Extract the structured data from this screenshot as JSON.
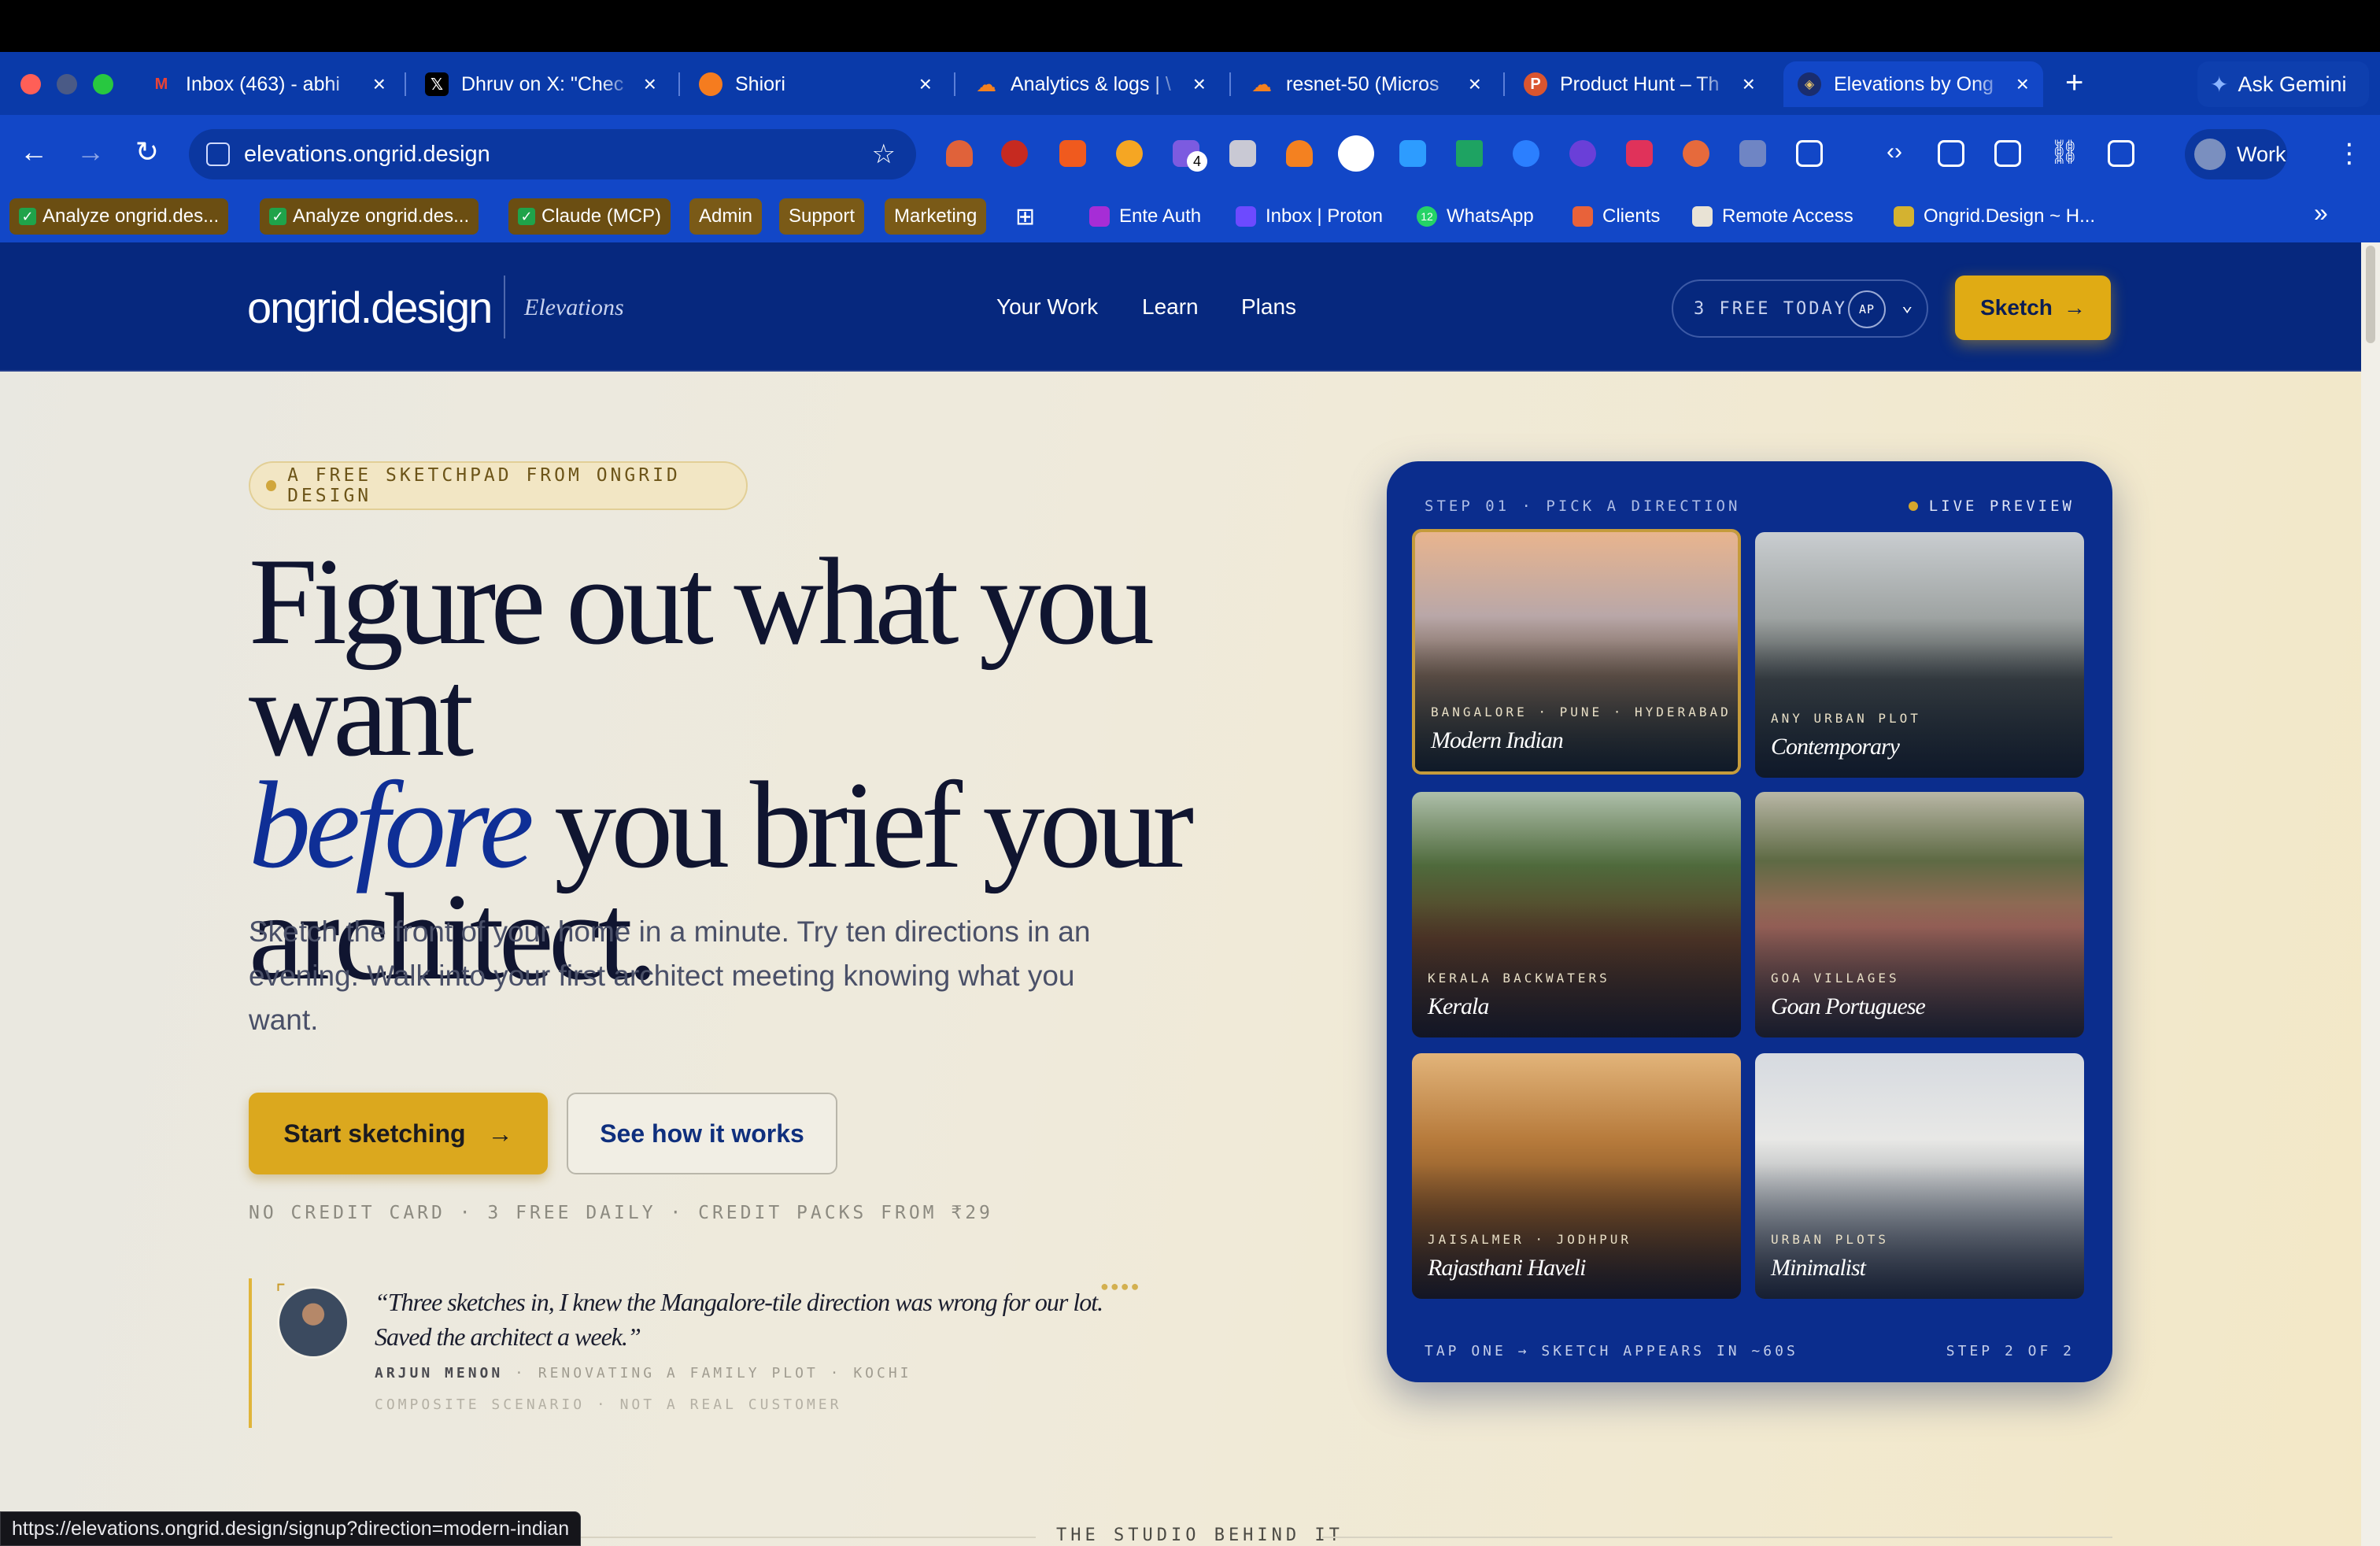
{
  "browser": {
    "tabs": [
      {
        "title": "Inbox (463) - abhi",
        "icon": "gmail-icon",
        "color": "#ea4335"
      },
      {
        "title": "Dhruv on X: \"Chec",
        "icon": "x-icon",
        "color": "#000000"
      },
      {
        "title": "Shiori",
        "icon": "shiori-icon",
        "color": "#f57c1f"
      },
      {
        "title": "Analytics & logs | \\",
        "icon": "cloudflare-icon",
        "color": "#f48120"
      },
      {
        "title": "resnet-50 (Micros",
        "icon": "cloudflare-icon",
        "color": "#f48120"
      },
      {
        "title": "Product Hunt – Th",
        "icon": "producthunt-icon",
        "color": "#da552f"
      },
      {
        "title": "Elevations by Ong",
        "icon": "ongrid-icon",
        "color": "#1a2d6e"
      }
    ],
    "new_tab": "+",
    "ask_gemini": "Ask Gemini",
    "url": "elevations.ongrid.design",
    "profile": "Work",
    "ext_badge": "4",
    "bookmarks": [
      {
        "label": "Analyze ongrid.des...",
        "kind": "check"
      },
      {
        "label": "Analyze ongrid.des...",
        "kind": "check"
      },
      {
        "label": "Claude (MCP)",
        "kind": "check"
      },
      {
        "label": "Admin",
        "kind": "pill"
      },
      {
        "label": "Support",
        "kind": "pill"
      },
      {
        "label": "Marketing",
        "kind": "pill"
      },
      {
        "label": "Ente Auth",
        "kind": "link"
      },
      {
        "label": "Inbox | Proton",
        "kind": "link"
      },
      {
        "label": "WhatsApp",
        "kind": "link"
      },
      {
        "label": "Clients",
        "kind": "link"
      },
      {
        "label": "Remote Access",
        "kind": "link"
      },
      {
        "label": "Ongrid.Design ~ H...",
        "kind": "link"
      }
    ],
    "whatsapp_badge": "12",
    "more_bookmarks": "»",
    "status_url": "https://elevations.ongrid.design/signup?direction=modern-indian"
  },
  "site": {
    "logo": "ongrid.design",
    "logo_tag": "Elevations",
    "nav": [
      "Your Work",
      "Learn",
      "Plans"
    ],
    "credits": "3 FREE TODAY",
    "avatar_initials": "AP",
    "cta": "Sketch",
    "eyebrow": "A FREE SKETCHPAD FROM ONGRID DESIGN",
    "headline_1": "Figure out what you want",
    "headline_em": "before",
    "headline_2": " you brief your",
    "headline_3": "architect.",
    "subtext": "Sketch the front of your home in a minute. Try ten directions in an evening. Walk into your first architect meeting knowing what you want.",
    "start_btn": "Start sketching",
    "how_btn": "See how it works",
    "fine_note": "NO CREDIT CARD · 3 FREE DAILY · CREDIT PACKS FROM ₹29",
    "quote": "“Three sketches in, I knew the Mangalore-tile direction was wrong for our lot. Saved the architect a week.”",
    "quote_author": "ARJUN MENON",
    "quote_role": " · RENOVATING A FAMILY PLOT · KOCHI",
    "quote_disclaimer": "COMPOSITE SCENARIO · NOT A REAL CUSTOMER",
    "studio_heading": "THE STUDIO BEHIND IT"
  },
  "preview": {
    "step_label": "STEP 01 · PICK A DIRECTION",
    "live": "LIVE PREVIEW",
    "tiles": [
      {
        "location": "BANGALORE · PUNE · HYDERABAD",
        "name": "Modern Indian",
        "selected": true
      },
      {
        "location": "ANY URBAN PLOT",
        "name": "Contemporary",
        "selected": false
      },
      {
        "location": "KERALA BACKWATERS",
        "name": "Kerala",
        "selected": false
      },
      {
        "location": "GOA VILLAGES",
        "name": "Goan Portuguese",
        "selected": false
      },
      {
        "location": "JAISALMER · JODHPUR",
        "name": "Rajasthani Haveli",
        "selected": false
      },
      {
        "location": "URBAN PLOTS",
        "name": "Minimalist",
        "selected": false
      }
    ],
    "footer": "TAP ONE → SKETCH APPEARS IN ~60S",
    "step_of": "STEP 2 OF 2"
  },
  "colors": {
    "nav_bg": "#06287e",
    "accent_gold": "#dba81e",
    "card_bg": "#0b2d8d",
    "browser_blue": "#1247c7"
  }
}
